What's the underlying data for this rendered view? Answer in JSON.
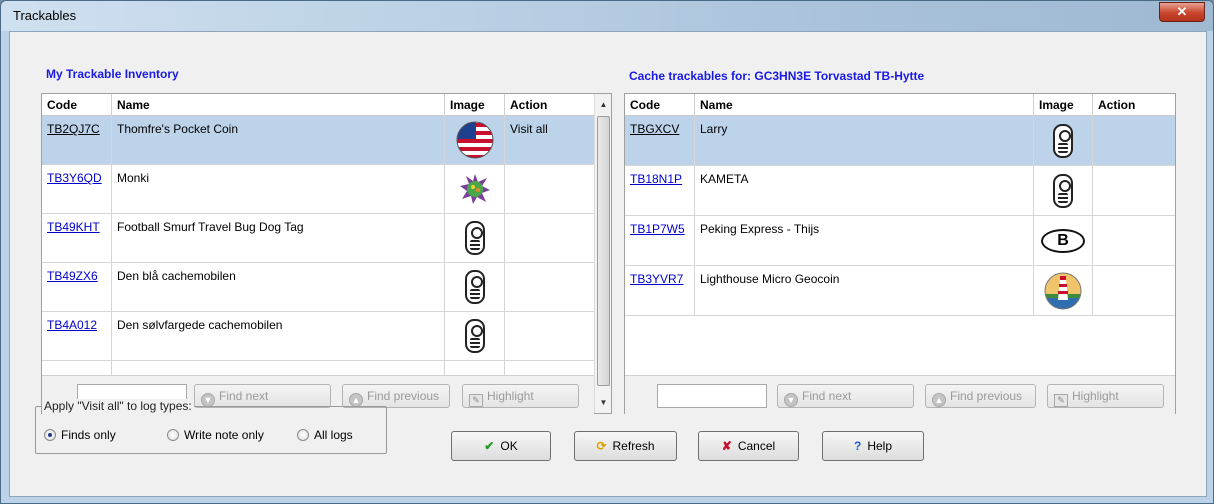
{
  "window": {
    "title": "Trackables",
    "close_glyph": "✕"
  },
  "left": {
    "title": "My Trackable Inventory",
    "columns": [
      "Code",
      "Name",
      "Image",
      "Action"
    ],
    "rows": [
      {
        "code": "TB2QJ7C",
        "name": "Thomfre's Pocket Coin",
        "image": "usa-flag-coin-icon",
        "action": "Visit all"
      },
      {
        "code": "TB3Y6QD",
        "name": "Monki",
        "image": "monkey-coin-icon",
        "action": ""
      },
      {
        "code": "TB49KHT",
        "name": "Football Smurf Travel Bug Dog Tag",
        "image": "travel-bug-icon",
        "action": ""
      },
      {
        "code": "TB49ZX6",
        "name": "Den blå cachemobilen",
        "image": "travel-bug-icon",
        "action": ""
      },
      {
        "code": "TB4A012",
        "name": "Den sølvfargede cachemobilen",
        "image": "travel-bug-icon",
        "action": ""
      }
    ],
    "find_next": "Find next",
    "find_previous": "Find previous",
    "highlight": "Highlight"
  },
  "right": {
    "title": "Cache trackables for: GC3HN3E Torvastad TB-Hytte",
    "columns": [
      "Code",
      "Name",
      "Image",
      "Action"
    ],
    "rows": [
      {
        "code": "TBGXCV",
        "name": "Larry",
        "image": "travel-bug-icon",
        "action": ""
      },
      {
        "code": "TB18N1P",
        "name": "KAMETA",
        "image": "travel-bug-icon",
        "action": ""
      },
      {
        "code": "TB1P7W5",
        "name": "Peking Express - Thijs",
        "image": "belgium-oval-icon",
        "image_text": "B",
        "action": ""
      },
      {
        "code": "TB3YVR7",
        "name": "Lighthouse Micro Geocoin",
        "image": "lighthouse-coin-icon",
        "action": ""
      }
    ],
    "find_next": "Find next",
    "find_previous": "Find previous",
    "highlight": "Highlight"
  },
  "visit_all": {
    "legend": "Apply \"Visit all\" to log types:",
    "options": [
      "Finds only",
      "Write note only",
      "All logs"
    ],
    "selected": "Finds only"
  },
  "buttons": {
    "ok": "OK",
    "refresh": "Refresh",
    "cancel": "Cancel",
    "help": "Help"
  },
  "colors": {
    "title_blue": "#1a1ae6",
    "link_blue": "#0000cc",
    "selected_row": "#bcd3ea",
    "cancel_red": "#c8102e",
    "ok_green": "#2a9a2a"
  }
}
